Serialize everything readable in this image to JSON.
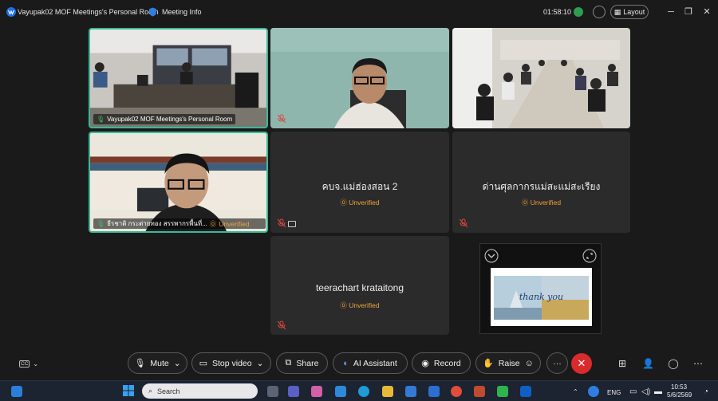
{
  "window": {
    "title": "Vayupak02 MOF Meetings's Personal Room",
    "meeting_info_label": "Meeting Info",
    "elapsed_time": "01:58:10",
    "layout_label": "Layout"
  },
  "participants": {
    "p1_name": "Vayupak02 MOF Meetings's Personal Room",
    "p5_name": "ธีรชาติ กระต่ายทอง สรรพากรพื้นที่...",
    "p5_status": "Unverified",
    "p6_name": "คบจ.แม่ฮ่องสอน 2",
    "p6_status": "Unverified",
    "p7_name": "ด่านศุลกากรแม่สะแม่สะเรียง",
    "p7_status": "Unverified",
    "p8_name": "teerachart krataitong",
    "p8_status": "Unverified"
  },
  "share": {
    "thumbnail_text": "thank you"
  },
  "controls": {
    "mute_label": "Mute",
    "stop_video_label": "Stop video",
    "share_label": "Share",
    "ai_label": "AI Assistant",
    "record_label": "Record",
    "raise_label": "Raise",
    "more_label": "···",
    "cc_label": "CC"
  },
  "taskbar": {
    "search_placeholder": "Search",
    "lang": "ENG",
    "time": "10:53",
    "date": "5/6/2569"
  },
  "colors": {
    "accent_border": "#3ab99a",
    "unverified": "#f0a23b",
    "end_call": "#d92b2b"
  }
}
